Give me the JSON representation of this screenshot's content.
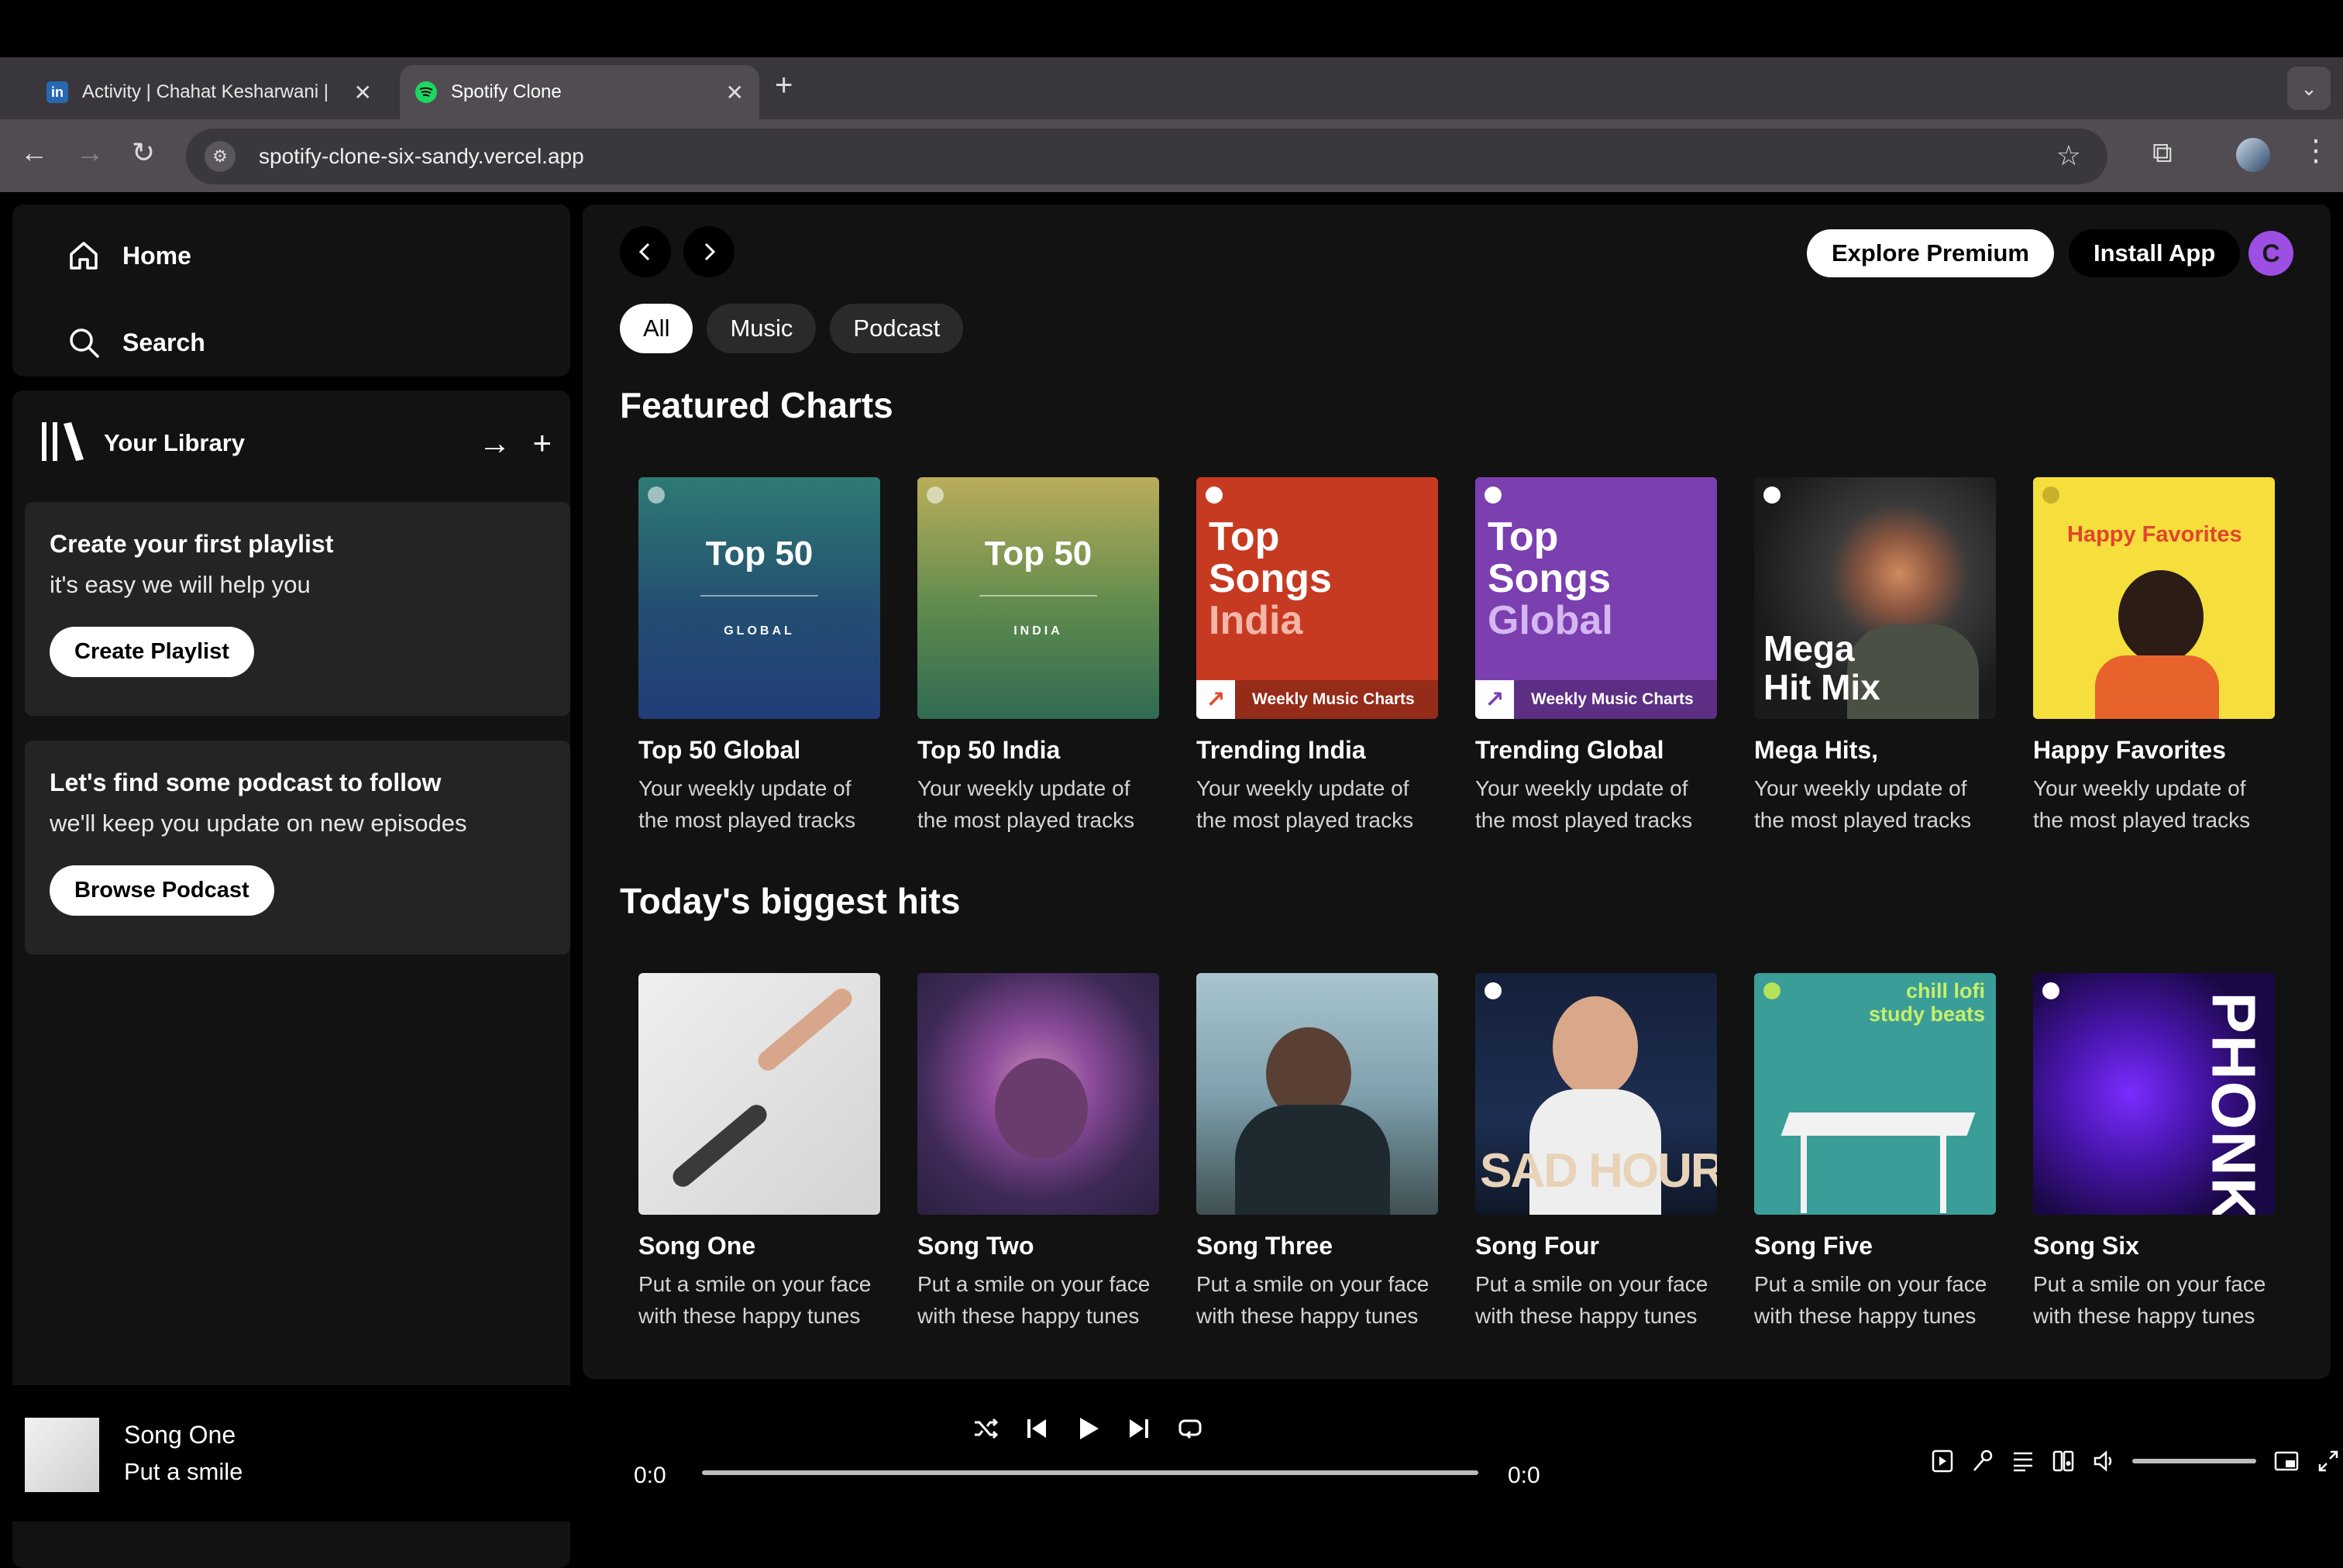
{
  "browser": {
    "tabs": [
      {
        "title": "Activity | Chahat Kesharwani |",
        "favicon": "linkedin-icon"
      },
      {
        "title": "Spotify Clone",
        "favicon": "spotify-icon"
      }
    ],
    "url": "spotify-clone-six-sandy.vercel.app"
  },
  "sidebar": {
    "nav": [
      {
        "label": "Home",
        "icon": "home-icon"
      },
      {
        "label": "Search",
        "icon": "search-icon"
      }
    ],
    "library": {
      "label": "Your Library",
      "cards": [
        {
          "title": "Create your first playlist",
          "text": "it's easy we will help you",
          "button": "Create Playlist"
        },
        {
          "title": "Let's find some podcast to follow",
          "text": "we'll keep you update on new episodes",
          "button": "Browse Podcast"
        }
      ]
    }
  },
  "header": {
    "explore": "Explore Premium",
    "install": "Install App",
    "avatar": "C"
  },
  "chips": [
    "All",
    "Music",
    "Podcast"
  ],
  "sections": [
    {
      "title": "Featured Charts",
      "items": [
        {
          "title": "Top 50 Global",
          "desc": "Your weekly update of the most played tracks",
          "art": {
            "big": "Top 50",
            "small": "GLOBAL"
          }
        },
        {
          "title": "Top 50 India",
          "desc": "Your weekly update of the most played tracks",
          "art": {
            "big": "Top 50",
            "small": "INDIA"
          }
        },
        {
          "title": "Trending India",
          "desc": "Your weekly update of the most played tracks",
          "art": {
            "lines": [
              "Top",
              "Songs",
              "India"
            ],
            "footer": "Weekly Music Charts"
          }
        },
        {
          "title": "Trending Global",
          "desc": "Your weekly update of the most played tracks",
          "art": {
            "lines": [
              "Top",
              "Songs",
              "Global"
            ],
            "footer": "Weekly Music Charts"
          }
        },
        {
          "title": "Mega Hits,",
          "desc": "Your weekly update of the most played tracks",
          "art": {
            "lines": [
              "Mega",
              "Hit Mix"
            ]
          }
        },
        {
          "title": "Happy Favorites",
          "desc": "Your weekly update of the most played tracks",
          "art": {
            "text": "Happy Favorites"
          }
        }
      ]
    },
    {
      "title": "Today's biggest hits",
      "items": [
        {
          "title": "Song One",
          "desc": "Put a smile on your face with these happy tunes"
        },
        {
          "title": "Song Two",
          "desc": "Put a smile on your face with these happy tunes"
        },
        {
          "title": "Song Three",
          "desc": "Put a smile on your face with these happy tunes"
        },
        {
          "title": "Song Four",
          "desc": "Put a smile on your face with these happy tunes",
          "art": {
            "text": "SAD HOUR"
          }
        },
        {
          "title": "Song Five",
          "desc": "Put a smile on your face with these happy tunes",
          "art": {
            "lines": [
              "chill lofi",
              "study beats"
            ]
          }
        },
        {
          "title": "Song Six",
          "desc": "Put a smile on your face with these happy tunes",
          "art": {
            "text": "PHONK"
          }
        }
      ]
    }
  ],
  "player": {
    "title": "Song One",
    "subtitle": "Put a smile",
    "current_time": "0:0",
    "total_time": "0:0",
    "progress": 0
  },
  "colors": {
    "accent_green": "#1ed760",
    "avatar_purple": "#9c4fe2",
    "panel": "#121212"
  }
}
